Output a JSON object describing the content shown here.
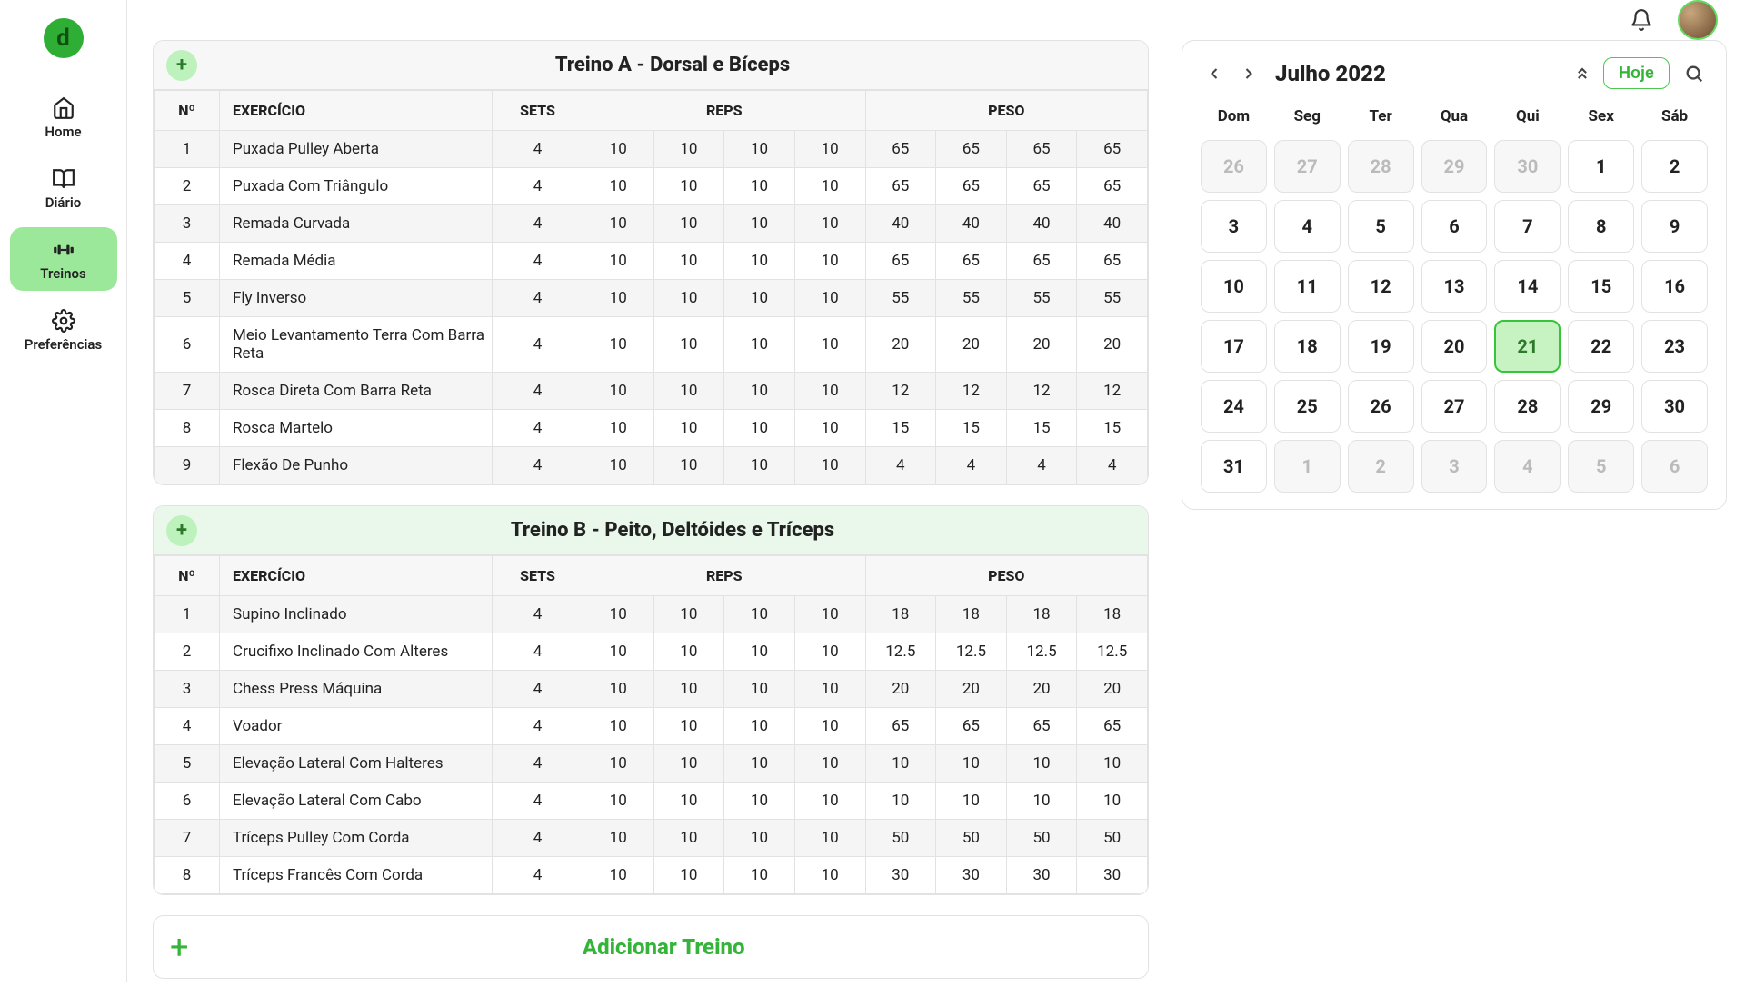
{
  "brand": {
    "logo_letter": "d"
  },
  "sidebar": {
    "items": [
      {
        "id": "home",
        "label": "Home",
        "icon": "home-icon"
      },
      {
        "id": "diario",
        "label": "Diário",
        "icon": "book-icon"
      },
      {
        "id": "treinos",
        "label": "Treinos",
        "icon": "dumbbell-icon",
        "active": true
      },
      {
        "id": "preferencias",
        "label": "Preferências",
        "icon": "gear-icon"
      }
    ]
  },
  "topbar": {
    "bell": "bell-icon",
    "avatar": "user-avatar"
  },
  "table_headers": {
    "n": "Nº",
    "exercise": "EXERCÍCIO",
    "sets": "SETS",
    "reps": "REPS",
    "weight": "PESO"
  },
  "workouts": [
    {
      "title": "Treino A - Dorsal e Bíceps",
      "accent": false,
      "exercises": [
        {
          "n": 1,
          "name": "Puxada Pulley Aberta",
          "sets": 4,
          "reps": [
            10,
            10,
            10,
            10
          ],
          "weight": [
            65,
            65,
            65,
            65
          ]
        },
        {
          "n": 2,
          "name": "Puxada Com Triângulo",
          "sets": 4,
          "reps": [
            10,
            10,
            10,
            10
          ],
          "weight": [
            65,
            65,
            65,
            65
          ]
        },
        {
          "n": 3,
          "name": "Remada Curvada",
          "sets": 4,
          "reps": [
            10,
            10,
            10,
            10
          ],
          "weight": [
            40,
            40,
            40,
            40
          ]
        },
        {
          "n": 4,
          "name": "Remada Média",
          "sets": 4,
          "reps": [
            10,
            10,
            10,
            10
          ],
          "weight": [
            65,
            65,
            65,
            65
          ]
        },
        {
          "n": 5,
          "name": "Fly Inverso",
          "sets": 4,
          "reps": [
            10,
            10,
            10,
            10
          ],
          "weight": [
            55,
            55,
            55,
            55
          ]
        },
        {
          "n": 6,
          "name": "Meio Levantamento Terra Com Barra Reta",
          "sets": 4,
          "reps": [
            10,
            10,
            10,
            10
          ],
          "weight": [
            20,
            20,
            20,
            20
          ]
        },
        {
          "n": 7,
          "name": "Rosca Direta Com Barra Reta",
          "sets": 4,
          "reps": [
            10,
            10,
            10,
            10
          ],
          "weight": [
            12,
            12,
            12,
            12
          ]
        },
        {
          "n": 8,
          "name": "Rosca Martelo",
          "sets": 4,
          "reps": [
            10,
            10,
            10,
            10
          ],
          "weight": [
            15,
            15,
            15,
            15
          ]
        },
        {
          "n": 9,
          "name": "Flexão De Punho",
          "sets": 4,
          "reps": [
            10,
            10,
            10,
            10
          ],
          "weight": [
            4,
            4,
            4,
            4
          ]
        }
      ]
    },
    {
      "title": "Treino B - Peito, Deltóides e Tríceps",
      "accent": true,
      "exercises": [
        {
          "n": 1,
          "name": "Supino Inclinado",
          "sets": 4,
          "reps": [
            10,
            10,
            10,
            10
          ],
          "weight": [
            18,
            18,
            18,
            18
          ]
        },
        {
          "n": 2,
          "name": "Crucifixo Inclinado Com Alteres",
          "sets": 4,
          "reps": [
            10,
            10,
            10,
            10
          ],
          "weight": [
            12.5,
            12.5,
            12.5,
            12.5
          ]
        },
        {
          "n": 3,
          "name": "Chess Press Máquina",
          "sets": 4,
          "reps": [
            10,
            10,
            10,
            10
          ],
          "weight": [
            20,
            20,
            20,
            20
          ]
        },
        {
          "n": 4,
          "name": "Voador",
          "sets": 4,
          "reps": [
            10,
            10,
            10,
            10
          ],
          "weight": [
            65,
            65,
            65,
            65
          ]
        },
        {
          "n": 5,
          "name": "Elevação Lateral Com Halteres",
          "sets": 4,
          "reps": [
            10,
            10,
            10,
            10
          ],
          "weight": [
            10,
            10,
            10,
            10
          ]
        },
        {
          "n": 6,
          "name": "Elevação Lateral Com Cabo",
          "sets": 4,
          "reps": [
            10,
            10,
            10,
            10
          ],
          "weight": [
            10,
            10,
            10,
            10
          ]
        },
        {
          "n": 7,
          "name": "Tríceps Pulley Com Corda",
          "sets": 4,
          "reps": [
            10,
            10,
            10,
            10
          ],
          "weight": [
            50,
            50,
            50,
            50
          ]
        },
        {
          "n": 8,
          "name": "Tríceps Francês Com Corda",
          "sets": 4,
          "reps": [
            10,
            10,
            10,
            10
          ],
          "weight": [
            30,
            30,
            30,
            30
          ]
        }
      ]
    }
  ],
  "add_workout_label": "Adicionar Treino",
  "calendar": {
    "title": "Julho 2022",
    "today_label": "Hoje",
    "dow": [
      "Dom",
      "Seg",
      "Ter",
      "Qua",
      "Qui",
      "Sex",
      "Sáb"
    ],
    "days": [
      {
        "d": 26,
        "muted": true
      },
      {
        "d": 27,
        "muted": true
      },
      {
        "d": 28,
        "muted": true
      },
      {
        "d": 29,
        "muted": true
      },
      {
        "d": 30,
        "muted": true
      },
      {
        "d": 1
      },
      {
        "d": 2
      },
      {
        "d": 3
      },
      {
        "d": 4
      },
      {
        "d": 5
      },
      {
        "d": 6
      },
      {
        "d": 7
      },
      {
        "d": 8
      },
      {
        "d": 9
      },
      {
        "d": 10
      },
      {
        "d": 11
      },
      {
        "d": 12
      },
      {
        "d": 13
      },
      {
        "d": 14
      },
      {
        "d": 15
      },
      {
        "d": 16
      },
      {
        "d": 17
      },
      {
        "d": 18
      },
      {
        "d": 19
      },
      {
        "d": 20
      },
      {
        "d": 21,
        "today": true
      },
      {
        "d": 22
      },
      {
        "d": 23
      },
      {
        "d": 24
      },
      {
        "d": 25
      },
      {
        "d": 26
      },
      {
        "d": 27
      },
      {
        "d": 28
      },
      {
        "d": 29
      },
      {
        "d": 30
      },
      {
        "d": 31
      },
      {
        "d": 1,
        "muted": true
      },
      {
        "d": 2,
        "muted": true
      },
      {
        "d": 3,
        "muted": true
      },
      {
        "d": 4,
        "muted": true
      },
      {
        "d": 5,
        "muted": true
      },
      {
        "d": 6,
        "muted": true
      }
    ]
  }
}
